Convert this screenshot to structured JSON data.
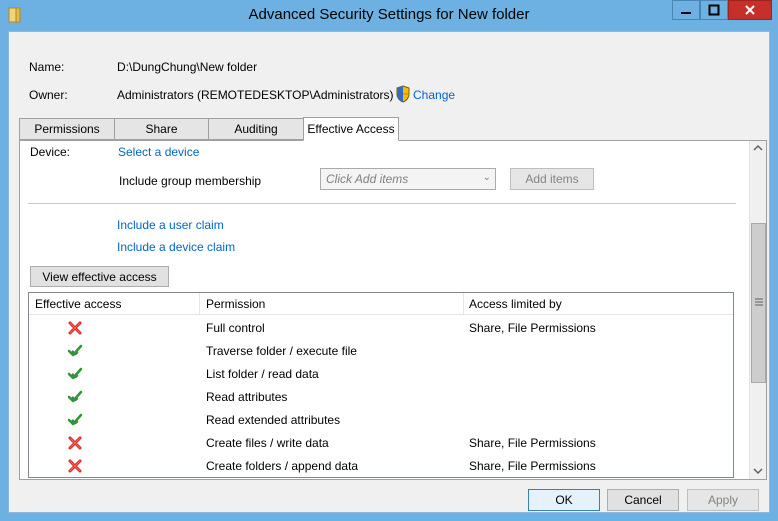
{
  "window": {
    "title": "Advanced Security Settings for New folder"
  },
  "name": {
    "label": "Name:",
    "value": "D:\\DungChung\\New folder"
  },
  "owner": {
    "label": "Owner:",
    "value": "Administrators (REMOTEDESKTOP\\Administrators)",
    "change_link": "Change"
  },
  "tabs": [
    {
      "label": "Permissions"
    },
    {
      "label": "Share"
    },
    {
      "label": "Auditing"
    },
    {
      "label": "Effective Access",
      "active": true
    }
  ],
  "effective": {
    "device_label": "Device:",
    "select_device_link": "Select a device",
    "include_group_label": "Include group membership",
    "combo_placeholder": "Click Add items",
    "add_items_button": "Add items",
    "user_claim_link": "Include a user claim",
    "device_claim_link": "Include a device claim",
    "view_button": "View effective access"
  },
  "table": {
    "headers": [
      "Effective access",
      "Permission",
      "Access limited by"
    ],
    "rows": [
      {
        "allowed": false,
        "permission": "Full control",
        "limited_by": "Share, File Permissions"
      },
      {
        "allowed": true,
        "permission": "Traverse folder / execute file",
        "limited_by": ""
      },
      {
        "allowed": true,
        "permission": "List folder / read data",
        "limited_by": ""
      },
      {
        "allowed": true,
        "permission": "Read attributes",
        "limited_by": ""
      },
      {
        "allowed": true,
        "permission": "Read extended attributes",
        "limited_by": ""
      },
      {
        "allowed": false,
        "permission": "Create files / write data",
        "limited_by": "Share, File Permissions"
      },
      {
        "allowed": false,
        "permission": "Create folders / append data",
        "limited_by": "Share, File Permissions"
      }
    ]
  },
  "buttons": {
    "ok": "OK",
    "cancel": "Cancel",
    "apply": "Apply"
  },
  "icons": {
    "window": "folder-icon",
    "change": "uac-shield-icon",
    "deny": "red-x-icon",
    "allow": "green-check-icon"
  }
}
